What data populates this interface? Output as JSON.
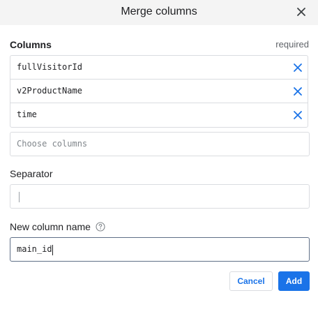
{
  "dialog": {
    "title": "Merge columns"
  },
  "columns": {
    "label": "Columns",
    "required_text": "required",
    "selected": [
      {
        "name": "fullVisitorId"
      },
      {
        "name": "v2ProductName"
      },
      {
        "name": "time"
      }
    ],
    "chooser_placeholder": "Choose columns"
  },
  "separator": {
    "label": "Separator",
    "value": ""
  },
  "new_column": {
    "label": "New column name",
    "value": "main_id"
  },
  "actions": {
    "cancel_label": "Cancel",
    "add_label": "Add"
  },
  "colors": {
    "accent": "#1a73e8",
    "header_bg": "#f4f4f4",
    "border": "#dadce0"
  },
  "icons": {
    "close": "close-icon",
    "remove": "remove-column-icon",
    "help": "help-circle-icon"
  }
}
